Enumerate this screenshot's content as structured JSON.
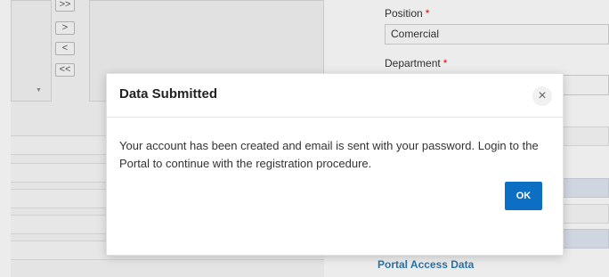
{
  "background": {
    "move_buttons": [
      ">>",
      ">",
      "<",
      "<<"
    ],
    "scroll_arrow": "▼",
    "position_label": "Position",
    "position_value": "Comercial",
    "department_label": "Department",
    "required_mark": "*",
    "section_link": "Portal Access Data"
  },
  "modal": {
    "title": "Data Submitted",
    "close_glyph": "×",
    "message": "Your account has been created and email is sent with your password. Login to the Portal to continue with the registration procedure.",
    "ok_label": "OK"
  },
  "colors": {
    "ok_button": "#0d6fc4",
    "required": "#dd1111",
    "section_link": "#2b7bb6"
  }
}
